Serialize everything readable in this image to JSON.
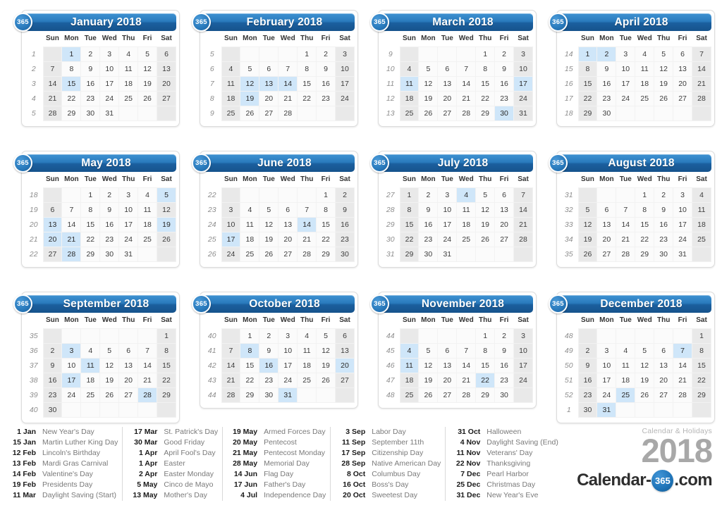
{
  "title": "Calendar 2018",
  "brand": {
    "caption": "Calendar & Holidays",
    "year": "2018",
    "logo_prefix": "Calendar-",
    "logo_badge": "365",
    "logo_suffix": ".com"
  },
  "badge_label": "365",
  "dow": [
    "Sun",
    "Mon",
    "Tue",
    "Wed",
    "Thu",
    "Fri",
    "Sat"
  ],
  "colors": {
    "header_blue": "#2a7bbd",
    "highlight_blue": "#cfe6f9",
    "weekend_gray": "#e9e9e9",
    "day_bg": "#fbfbfb",
    "legend_name": "#7a7a7a",
    "brand_gray": "#a8a8a8"
  },
  "months": [
    {
      "name": "January 2018",
      "weeks": [
        "1",
        "2",
        "3",
        "4",
        "5"
      ],
      "days": [
        [
          "",
          "1",
          "2",
          "3",
          "4",
          "5",
          "6"
        ],
        [
          "7",
          "8",
          "9",
          "10",
          "11",
          "12",
          "13"
        ],
        [
          "14",
          "15",
          "16",
          "17",
          "18",
          "19",
          "20"
        ],
        [
          "21",
          "22",
          "23",
          "24",
          "25",
          "26",
          "27"
        ],
        [
          "28",
          "29",
          "30",
          "31",
          "",
          "",
          ""
        ]
      ],
      "highlights": [
        "1",
        "15"
      ]
    },
    {
      "name": "February 2018",
      "weeks": [
        "5",
        "6",
        "7",
        "8",
        "9"
      ],
      "days": [
        [
          "",
          "",
          "",
          "",
          "1",
          "2",
          "3"
        ],
        [
          "4",
          "5",
          "6",
          "7",
          "8",
          "9",
          "10"
        ],
        [
          "11",
          "12",
          "13",
          "14",
          "15",
          "16",
          "17"
        ],
        [
          "18",
          "19",
          "20",
          "21",
          "22",
          "23",
          "24"
        ],
        [
          "25",
          "26",
          "27",
          "28",
          "",
          "",
          ""
        ]
      ],
      "highlights": [
        "12",
        "13",
        "14",
        "19"
      ]
    },
    {
      "name": "March 2018",
      "weeks": [
        "9",
        "10",
        "11",
        "12",
        "13"
      ],
      "days": [
        [
          "",
          "",
          "",
          "",
          "1",
          "2",
          "3"
        ],
        [
          "4",
          "5",
          "6",
          "7",
          "8",
          "9",
          "10"
        ],
        [
          "11",
          "12",
          "13",
          "14",
          "15",
          "16",
          "17"
        ],
        [
          "18",
          "19",
          "20",
          "21",
          "22",
          "23",
          "24"
        ],
        [
          "25",
          "26",
          "27",
          "28",
          "29",
          "30",
          "31"
        ]
      ],
      "highlights": [
        "11",
        "17",
        "30"
      ]
    },
    {
      "name": "April 2018",
      "weeks": [
        "14",
        "15",
        "16",
        "17",
        "18"
      ],
      "days": [
        [
          "1",
          "2",
          "3",
          "4",
          "5",
          "6",
          "7"
        ],
        [
          "8",
          "9",
          "10",
          "11",
          "12",
          "13",
          "14"
        ],
        [
          "15",
          "16",
          "17",
          "18",
          "19",
          "20",
          "21"
        ],
        [
          "22",
          "23",
          "24",
          "25",
          "26",
          "27",
          "28"
        ],
        [
          "29",
          "30",
          "",
          "",
          "",
          "",
          ""
        ]
      ],
      "highlights": [
        "1",
        "2"
      ]
    },
    {
      "name": "May 2018",
      "weeks": [
        "18",
        "19",
        "20",
        "21",
        "22"
      ],
      "days": [
        [
          "",
          "",
          "1",
          "2",
          "3",
          "4",
          "5"
        ],
        [
          "6",
          "7",
          "8",
          "9",
          "10",
          "11",
          "12"
        ],
        [
          "13",
          "14",
          "15",
          "16",
          "17",
          "18",
          "19"
        ],
        [
          "20",
          "21",
          "22",
          "23",
          "24",
          "25",
          "26"
        ],
        [
          "27",
          "28",
          "29",
          "30",
          "31",
          "",
          ""
        ]
      ],
      "highlights": [
        "5",
        "13",
        "19",
        "20",
        "21",
        "28"
      ]
    },
    {
      "name": "June 2018",
      "weeks": [
        "22",
        "23",
        "24",
        "25",
        "26"
      ],
      "days": [
        [
          "",
          "",
          "",
          "",
          "",
          "1",
          "2"
        ],
        [
          "3",
          "4",
          "5",
          "6",
          "7",
          "8",
          "9"
        ],
        [
          "10",
          "11",
          "12",
          "13",
          "14",
          "15",
          "16"
        ],
        [
          "17",
          "18",
          "19",
          "20",
          "21",
          "22",
          "23"
        ],
        [
          "24",
          "25",
          "26",
          "27",
          "28",
          "29",
          "30"
        ]
      ],
      "highlights": [
        "14",
        "17"
      ]
    },
    {
      "name": "July 2018",
      "weeks": [
        "27",
        "28",
        "29",
        "30",
        "31"
      ],
      "days": [
        [
          "1",
          "2",
          "3",
          "4",
          "5",
          "6",
          "7"
        ],
        [
          "8",
          "9",
          "10",
          "11",
          "12",
          "13",
          "14"
        ],
        [
          "15",
          "16",
          "17",
          "18",
          "19",
          "20",
          "21"
        ],
        [
          "22",
          "23",
          "24",
          "25",
          "26",
          "27",
          "28"
        ],
        [
          "29",
          "30",
          "31",
          "",
          "",
          "",
          ""
        ]
      ],
      "highlights": [
        "4"
      ]
    },
    {
      "name": "August 2018",
      "weeks": [
        "31",
        "32",
        "33",
        "34",
        "35"
      ],
      "days": [
        [
          "",
          "",
          "",
          "1",
          "2",
          "3",
          "4"
        ],
        [
          "5",
          "6",
          "7",
          "8",
          "9",
          "10",
          "11"
        ],
        [
          "12",
          "13",
          "14",
          "15",
          "16",
          "17",
          "18"
        ],
        [
          "19",
          "20",
          "21",
          "22",
          "23",
          "24",
          "25"
        ],
        [
          "26",
          "27",
          "28",
          "29",
          "30",
          "31",
          ""
        ]
      ],
      "highlights": []
    },
    {
      "name": "September 2018",
      "weeks": [
        "35",
        "36",
        "37",
        "38",
        "39",
        "40"
      ],
      "days": [
        [
          "",
          "",
          "",
          "",
          "",
          "",
          "1"
        ],
        [
          "2",
          "3",
          "4",
          "5",
          "6",
          "7",
          "8"
        ],
        [
          "9",
          "10",
          "11",
          "12",
          "13",
          "14",
          "15"
        ],
        [
          "16",
          "17",
          "18",
          "19",
          "20",
          "21",
          "22"
        ],
        [
          "23",
          "24",
          "25",
          "26",
          "27",
          "28",
          "29"
        ],
        [
          "30",
          "",
          "",
          "",
          "",
          "",
          ""
        ]
      ],
      "highlights": [
        "3",
        "11",
        "17",
        "28"
      ]
    },
    {
      "name": "October 2018",
      "weeks": [
        "40",
        "41",
        "42",
        "43",
        "44"
      ],
      "days": [
        [
          "",
          "1",
          "2",
          "3",
          "4",
          "5",
          "6"
        ],
        [
          "7",
          "8",
          "9",
          "10",
          "11",
          "12",
          "13"
        ],
        [
          "14",
          "15",
          "16",
          "17",
          "18",
          "19",
          "20"
        ],
        [
          "21",
          "22",
          "23",
          "24",
          "25",
          "26",
          "27"
        ],
        [
          "28",
          "29",
          "30",
          "31",
          "",
          "",
          ""
        ]
      ],
      "highlights": [
        "8",
        "16",
        "20",
        "31"
      ]
    },
    {
      "name": "November 2018",
      "weeks": [
        "44",
        "45",
        "46",
        "47",
        "48"
      ],
      "days": [
        [
          "",
          "",
          "",
          "",
          "1",
          "2",
          "3"
        ],
        [
          "4",
          "5",
          "6",
          "7",
          "8",
          "9",
          "10"
        ],
        [
          "11",
          "12",
          "13",
          "14",
          "15",
          "16",
          "17"
        ],
        [
          "18",
          "19",
          "20",
          "21",
          "22",
          "23",
          "24"
        ],
        [
          "25",
          "26",
          "27",
          "28",
          "29",
          "30",
          ""
        ]
      ],
      "highlights": [
        "4",
        "11",
        "22"
      ]
    },
    {
      "name": "December 2018",
      "weeks": [
        "48",
        "49",
        "50",
        "51",
        "52",
        "1"
      ],
      "days": [
        [
          "",
          "",
          "",
          "",
          "",
          "",
          "1"
        ],
        [
          "2",
          "3",
          "4",
          "5",
          "6",
          "7",
          "8"
        ],
        [
          "9",
          "10",
          "11",
          "12",
          "13",
          "14",
          "15"
        ],
        [
          "16",
          "17",
          "18",
          "19",
          "20",
          "21",
          "22"
        ],
        [
          "23",
          "24",
          "25",
          "26",
          "27",
          "28",
          "29"
        ],
        [
          "30",
          "31",
          "",
          "",
          "",
          "",
          ""
        ]
      ],
      "highlights": [
        "7",
        "25",
        "31"
      ]
    }
  ],
  "legend_columns": [
    [
      {
        "date": "1 Jan",
        "name": "New Year's Day"
      },
      {
        "date": "15 Jan",
        "name": "Martin Luther King Day"
      },
      {
        "date": "12 Feb",
        "name": "Lincoln's Birthday"
      },
      {
        "date": "13 Feb",
        "name": "Mardi Gras Carnival"
      },
      {
        "date": "14 Feb",
        "name": "Valentine's Day"
      },
      {
        "date": "19 Feb",
        "name": "Presidents Day"
      },
      {
        "date": "11 Mar",
        "name": "Daylight Saving (Start)"
      }
    ],
    [
      {
        "date": "17 Mar",
        "name": "St. Patrick's Day"
      },
      {
        "date": "30 Mar",
        "name": "Good Friday"
      },
      {
        "date": "1 Apr",
        "name": "April Fool's Day"
      },
      {
        "date": "1 Apr",
        "name": "Easter"
      },
      {
        "date": "2 Apr",
        "name": "Easter Monday"
      },
      {
        "date": "5 May",
        "name": "Cinco de Mayo"
      },
      {
        "date": "13 May",
        "name": "Mother's Day"
      }
    ],
    [
      {
        "date": "19 May",
        "name": "Armed Forces Day"
      },
      {
        "date": "20 May",
        "name": "Pentecost"
      },
      {
        "date": "21 May",
        "name": "Pentecost Monday"
      },
      {
        "date": "28 May",
        "name": "Memorial Day"
      },
      {
        "date": "14 Jun",
        "name": "Flag Day"
      },
      {
        "date": "17 Jun",
        "name": "Father's Day"
      },
      {
        "date": "4 Jul",
        "name": "Independence Day"
      }
    ],
    [
      {
        "date": "3 Sep",
        "name": "Labor Day"
      },
      {
        "date": "11 Sep",
        "name": "September 11th"
      },
      {
        "date": "17 Sep",
        "name": "Citizenship Day"
      },
      {
        "date": "28 Sep",
        "name": "Native American Day"
      },
      {
        "date": "8 Oct",
        "name": "Columbus Day"
      },
      {
        "date": "16 Oct",
        "name": "Boss's Day"
      },
      {
        "date": "20 Oct",
        "name": "Sweetest Day"
      }
    ],
    [
      {
        "date": "31 Oct",
        "name": "Halloween"
      },
      {
        "date": "4 Nov",
        "name": "Daylight Saving (End)"
      },
      {
        "date": "11 Nov",
        "name": "Veterans' Day"
      },
      {
        "date": "22 Nov",
        "name": "Thanksgiving"
      },
      {
        "date": "7 Dec",
        "name": "Pearl Harbor"
      },
      {
        "date": "25 Dec",
        "name": "Christmas Day"
      },
      {
        "date": "31 Dec",
        "name": "New Year's Eve"
      }
    ]
  ]
}
